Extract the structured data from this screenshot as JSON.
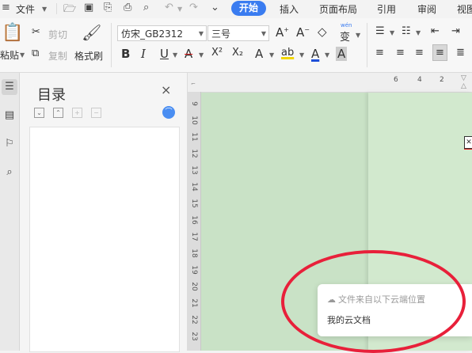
{
  "menubar": {
    "file_label": "文件",
    "tabs": [
      {
        "label": "开始",
        "active": true
      },
      {
        "label": "插入"
      },
      {
        "label": "页面布局"
      },
      {
        "label": "引用"
      },
      {
        "label": "审阅"
      },
      {
        "label": "视图"
      }
    ]
  },
  "ribbon": {
    "paste_label": "粘贴",
    "cut_label": "剪切",
    "copy_label": "复制",
    "format_painter_label": "格式刷",
    "font_name": "仿宋_GB2312",
    "font_size": "三号",
    "bold_glyph": "B",
    "italic_glyph": "I",
    "underline_glyph": "U",
    "font_color_glyph": "A",
    "char_shading_glyph": "A",
    "grow_font_glyph": "A",
    "shrink_font_glyph": "A",
    "clear_format_glyph": "◇",
    "phonetic_top": "wén",
    "phonetic_char": "变",
    "superscript_glyph": "X²",
    "subscript_glyph": "X₂",
    "text_effect_glyph": "A",
    "highlight_glyph": "ab"
  },
  "toc": {
    "title": "目录",
    "close_glyph": "×"
  },
  "ruler": {
    "horizontal": [
      "6",
      "4",
      "2"
    ],
    "vertical": [
      "9",
      "10",
      "11",
      "12",
      "13",
      "14",
      "15",
      "16",
      "17",
      "18",
      "19",
      "20",
      "21",
      "22",
      "23"
    ]
  },
  "tooltip": {
    "line1": "文件来自以下云端位置",
    "line2": "我的云文档"
  },
  "colors": {
    "accent": "#3a7cf0",
    "document_bg": "#c9e2c6",
    "highlight_ring": "#e8203a"
  }
}
